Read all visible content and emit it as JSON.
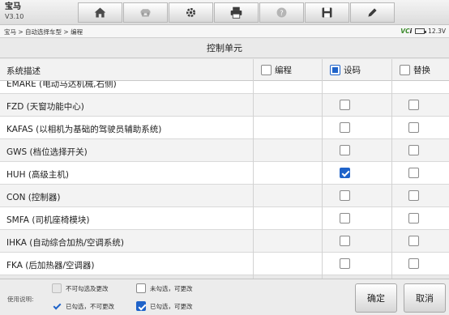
{
  "header": {
    "title": "宝马",
    "version": "V3.10"
  },
  "toolbar": [
    {
      "icon": "home-icon"
    },
    {
      "icon": "vehicle-swap-icon"
    },
    {
      "icon": "settings-gear-icon"
    },
    {
      "icon": "printer-icon"
    },
    {
      "icon": "help-icon"
    },
    {
      "icon": "save-icon"
    },
    {
      "icon": "edit-pencil-icon"
    }
  ],
  "breadcrumb": "宝马 > 自动选择车型 > 编程",
  "status": {
    "vci_label": "VC",
    "vci_suffix": "i",
    "voltage": "12.3V"
  },
  "page_title": "控制单元",
  "table": {
    "col_desc": "系统描述",
    "col_program": "编程",
    "col_coding": "设码",
    "col_replace": "替换",
    "coding_header_state": "partial",
    "rows": [
      {
        "name": "EMARE (电动马达机械,右侧)",
        "coding": false,
        "replace": false
      },
      {
        "name": "FZD (天窗功能中心)",
        "coding": false,
        "replace": false
      },
      {
        "name": "KAFAS (以相机为基础的驾驶员辅助系统)",
        "coding": false,
        "replace": false
      },
      {
        "name": "GWS (档位选择开关)",
        "coding": false,
        "replace": false
      },
      {
        "name": "HUH (高级主机)",
        "coding": true,
        "replace": false
      },
      {
        "name": "CON (控制器)",
        "coding": false,
        "replace": false
      },
      {
        "name": "SMFA (司机座椅模块)",
        "coding": false,
        "replace": false
      },
      {
        "name": "IHKA (自动综合加热/空调系统)",
        "coding": false,
        "replace": false
      },
      {
        "name": "FKA (后加热器/空调器)",
        "coding": false,
        "replace": false
      }
    ]
  },
  "legend": {
    "title": "使用说明:",
    "disabled_unchecked": "不可勾选及更改",
    "unchecked_editable": "未勾选，可更改",
    "checked_locked": "已勾选，不可更改",
    "checked_editable": "已勾选，可更改"
  },
  "buttons": {
    "confirm": "确定",
    "cancel": "取消"
  }
}
